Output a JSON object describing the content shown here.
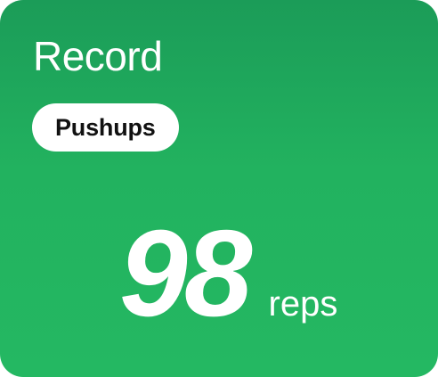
{
  "card": {
    "title": "Record",
    "exercise": "Pushups",
    "value": "98",
    "unit": "reps",
    "colors": {
      "background_top": "#1b9c58",
      "background_bottom": "#24b862",
      "pill_background": "#ffffff",
      "pill_text": "#111111",
      "text": "#ffffff"
    }
  }
}
